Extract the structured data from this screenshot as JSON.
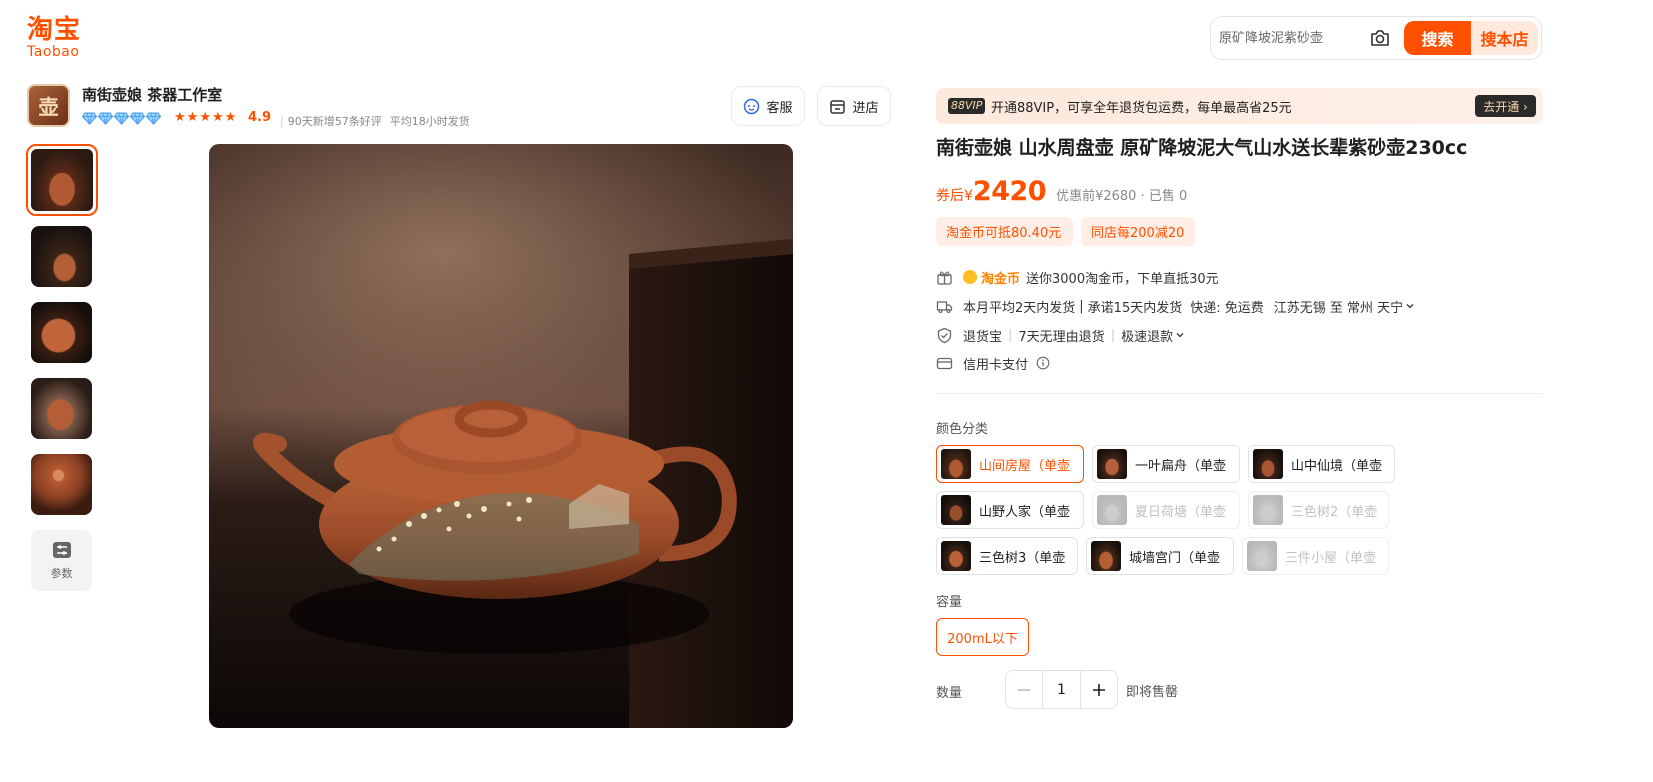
{
  "header": {
    "logo_cn": "淘宝",
    "logo_en": "Taobao",
    "search_placeholder": "原矿降坡泥紫砂壶",
    "search_button": "搜索",
    "search_shop_button": "搜本店",
    "brand_color": "#ff5000"
  },
  "shop": {
    "avatar_char": "壶",
    "name": "南街壶娘 茶器工作室",
    "diamond_level": 5,
    "stars": 5,
    "rating": "4.9",
    "stat_reviews": "90天新增57条好评",
    "stat_shipping": "平均18小时发货",
    "service_button": "客服",
    "enter_shop_button": "进店"
  },
  "gallery": {
    "thumbnails": [
      "teapot-1",
      "teapot-2",
      "teapot-3",
      "teapot-4",
      "teapot-5"
    ],
    "selected_index": 0,
    "params_label": "参数"
  },
  "vip": {
    "tag": "88VIP",
    "text": "开通88VIP，可享全年退货包运费，每单最高省25元",
    "button": "去开通 ›"
  },
  "product": {
    "title": "南街壶娘 山水周盘壶 原矿降坡泥大气山水送长辈紫砂壶230cc",
    "price_prefix": "券后¥",
    "price": "2420",
    "price_original": "优惠前¥2680 · 已售 0",
    "coupons": [
      "淘金币可抵80.40元",
      "同店每200减20"
    ]
  },
  "info": {
    "coin_badge": "淘金币",
    "coin_text": "送你3000淘金币，下单直抵30元",
    "ship_part1": "本月平均2天内发货",
    "ship_part2": "承诺15天内发货",
    "ship_part3": "快递: 免运费",
    "ship_part4": "江苏无锡 至 常州 天宁",
    "return_part1": "退货宝",
    "return_part2": "7天无理由退货",
    "return_part3": "极速退款",
    "credit_text": "信用卡支付"
  },
  "options": {
    "color_label": "颜色分类",
    "colors": [
      {
        "label": "山间房屋（单壶",
        "state": "active"
      },
      {
        "label": "一叶扁舟（单壶",
        "state": "normal"
      },
      {
        "label": "山中仙境（单壶",
        "state": "normal"
      },
      {
        "label": "山野人家（单壶",
        "state": "normal"
      },
      {
        "label": "夏日荷塘（单壶",
        "state": "disabled"
      },
      {
        "label": "三色树2（单壶",
        "state": "disabled"
      },
      {
        "label": "三色树3（单壶",
        "state": "normal"
      },
      {
        "label": "城墙宫门（单壶",
        "state": "normal"
      },
      {
        "label": "三件小屋（单壶",
        "state": "disabled"
      }
    ],
    "capacity_label": "容量",
    "capacity_value": "200mL以下",
    "quantity_label": "数量",
    "quantity_value": "1",
    "stock_note": "即将售罄"
  }
}
